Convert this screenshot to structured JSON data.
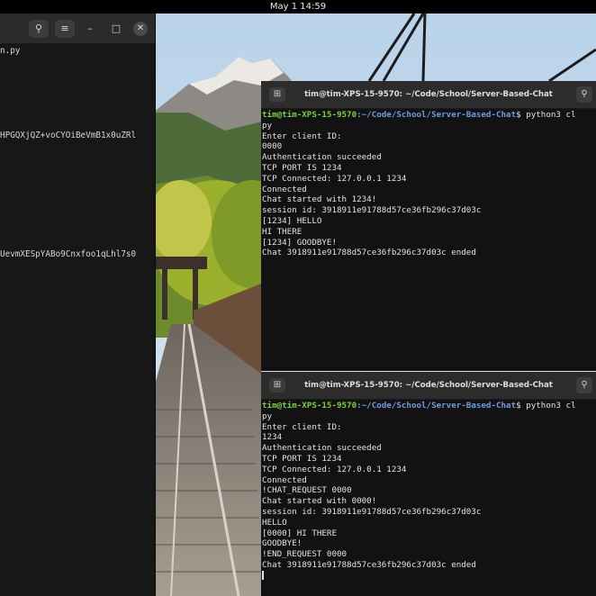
{
  "topbar": {
    "datetime": "May 1  14:59"
  },
  "left_terminal": {
    "header": {
      "search_icon": "search-icon",
      "menu_icon": "hamburger-menu-icon"
    },
    "lines": [
      "n.py",
      "HPGQXjQZ+voCYOiBeVmB1x0uZRl",
      "UevmXESpYABo9Cnxfoo1qLhl7s0"
    ]
  },
  "terminal_top": {
    "title": "tim@tim-XPS-15-9570: ~/Code/School/Server-Based-Chat",
    "prompt_user": "tim@tim-XPS-15-9570",
    "prompt_path": ":~/Code/School/Server-Based-Chat",
    "prompt_cmd": "$ python3 cl",
    "lines": [
      "py",
      "Enter client ID:",
      "0000",
      "Authentication succeeded",
      "TCP PORT IS 1234",
      "TCP Connected: 127.0.0.1 1234",
      "Connected",
      "Chat started with 1234!",
      "session id: 3918911e91788d57ce36fb296c37d03c",
      "[1234] HELLO",
      "HI THERE",
      "[1234] GOODBYE!",
      "Chat 3918911e91788d57ce36fb296c37d03c ended"
    ]
  },
  "terminal_bottom": {
    "title": "tim@tim-XPS-15-9570: ~/Code/School/Server-Based-Chat",
    "prompt_user": "tim@tim-XPS-15-9570",
    "prompt_path": ":~/Code/School/Server-Based-Chat",
    "prompt_cmd": "$ python3 cl",
    "lines": [
      "py",
      "Enter client ID:",
      "1234",
      "Authentication succeeded",
      "TCP PORT IS 1234",
      "TCP Connected: 127.0.0.1 1234",
      "Connected",
      "!CHAT_REQUEST 0000",
      "Chat started with 0000!",
      "session id: 3918911e91788d57ce36fb296c37d03c",
      "HELLO",
      "[0000] HI THERE",
      "GOODBYE!",
      "!END_REQUEST 0000",
      "Chat 3918911e91788d57ce36fb296c37d03c ended"
    ]
  },
  "colors": {
    "prompt_user": "#7ad13a",
    "prompt_path": "#6f9be0",
    "terminal_bg": "#121212",
    "header_bg": "#2c2c2c"
  }
}
